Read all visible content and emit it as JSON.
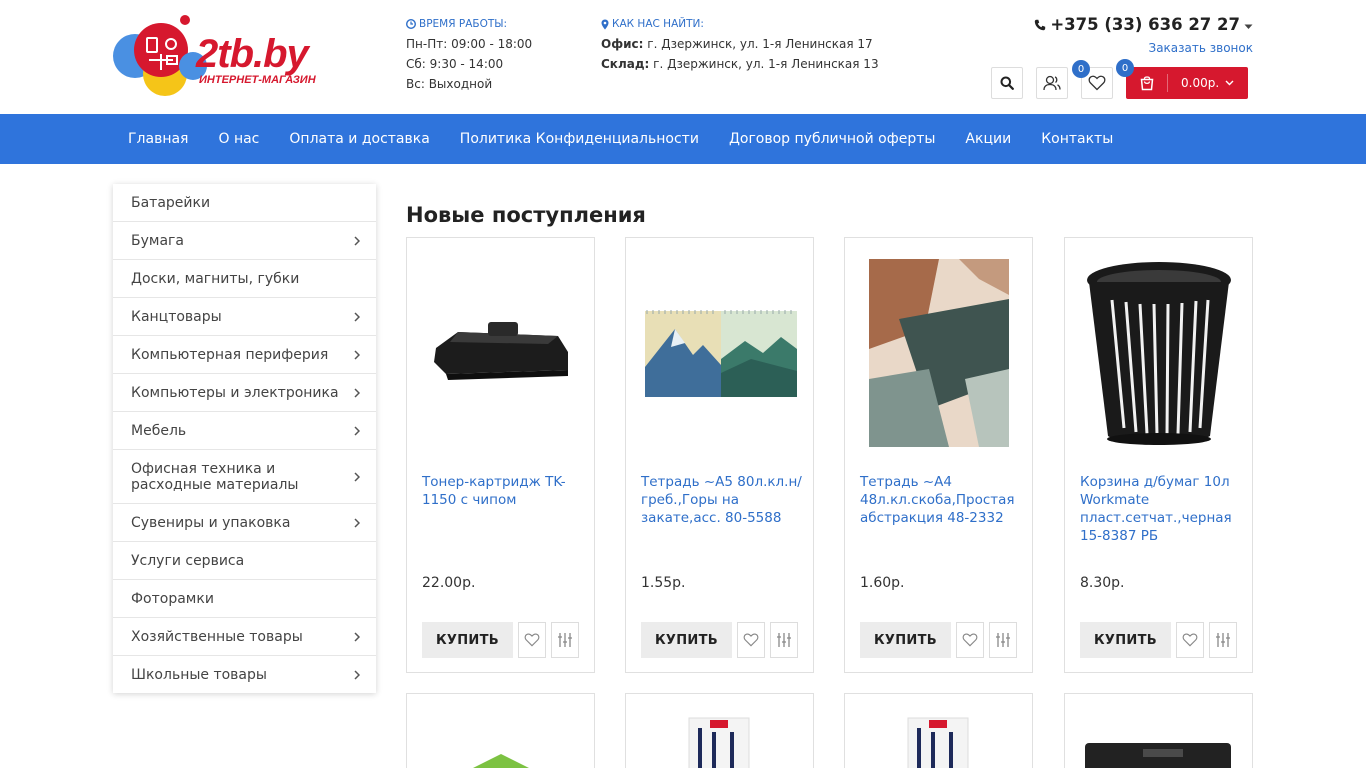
{
  "header": {
    "logo_text": "2tb.by",
    "logo_sub": "ИНТЕРНЕТ-МАГАЗИН",
    "hours": {
      "heading": "ВРЕМЯ РАБОТЫ:",
      "lines": [
        "Пн-Пт: 09:00 - 18:00",
        "Сб: 9:30 - 14:00",
        "Вс: Выходной"
      ]
    },
    "address": {
      "heading": "КАК НАС НАЙТИ:",
      "office_label": "Офис:",
      "office_value": "г. Дзержинск, ул. 1-я Ленинская 17",
      "warehouse_label": "Склад:",
      "warehouse_value": "г. Дзержинск, ул. 1-я Ленинская 13"
    },
    "phone": "+375 (33) 636 27 27",
    "callback_link": "Заказать звонок",
    "wishlist_count": "0",
    "cart_count": "0",
    "cart_total": "0.00р."
  },
  "nav": {
    "items": [
      "Главная",
      "О нас",
      "Оплата и доставка",
      "Политика Конфиденциальности",
      "Договор публичной оферты",
      "Акции",
      "Контакты"
    ]
  },
  "sidebar": {
    "items": [
      {
        "label": "Батарейки",
        "has_sub": false
      },
      {
        "label": "Бумага",
        "has_sub": true
      },
      {
        "label": "Доски, магниты, губки",
        "has_sub": false
      },
      {
        "label": "Канцтовары",
        "has_sub": true
      },
      {
        "label": "Компьютерная периферия",
        "has_sub": true
      },
      {
        "label": "Компьютеры и электроника",
        "has_sub": true
      },
      {
        "label": "Мебель",
        "has_sub": true
      },
      {
        "label": "Офисная техника и расходные материалы",
        "has_sub": true
      },
      {
        "label": "Сувениры и упаковка",
        "has_sub": true
      },
      {
        "label": "Услуги сервиса",
        "has_sub": false
      },
      {
        "label": "Фоторамки",
        "has_sub": false
      },
      {
        "label": "Хозяйственные товары",
        "has_sub": true
      },
      {
        "label": "Школьные товары",
        "has_sub": true
      }
    ]
  },
  "main": {
    "section_title": "Новые поступления",
    "buy_label": "КУПИТЬ",
    "products": [
      {
        "title": "Тонер-картридж TK-1150 с чипом",
        "price": "22.00р."
      },
      {
        "title": "Тетрадь ~А5 80л.кл.н/греб.,Горы на закате,асс. 80-5588",
        "price": "1.55р."
      },
      {
        "title": "Тетрадь ~А4 48л.кл.скоба,Простая абстракция 48-2332",
        "price": "1.60р."
      },
      {
        "title": "Корзина д/бумаг 10л Workmate пласт.сетчат.,черная 15-8387 РБ",
        "price": "8.30р."
      }
    ]
  },
  "colors": {
    "accent": "#2f74dc",
    "brand_red": "#d6182e",
    "link": "#2f6fc9"
  }
}
